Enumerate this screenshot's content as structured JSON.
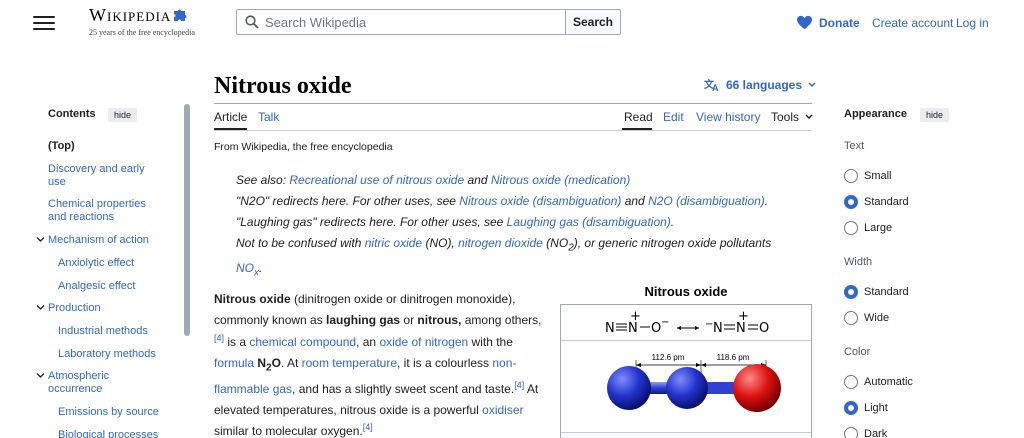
{
  "header": {
    "logo_word": "Wikipedia",
    "logo_tagline": "25 years of the free encyclopedia",
    "search_placeholder": "Search Wikipedia",
    "search_button": "Search",
    "donate": "Donate",
    "create_account": "Create account",
    "log_in": "Log in"
  },
  "page": {
    "title": "Nitrous oxide",
    "languages": "66 languages",
    "tabs": {
      "article": "Article",
      "talk": "Talk",
      "read": "Read",
      "edit": "Edit",
      "view_history": "View history",
      "tools": "Tools"
    },
    "from_wikipedia": "From Wikipedia, the free encyclopedia"
  },
  "hatnotes": {
    "line1": {
      "see_also": "See also: ",
      "link1": "Recreational use of nitrous oxide",
      "and": " and ",
      "link2": "Nitrous oxide (medication)"
    },
    "line2": {
      "pre": "\"N2O\" redirects here. For other uses, see ",
      "link1": "Nitrous oxide (disambiguation)",
      "and": " and ",
      "link2": "N2O (disambiguation)",
      "end": "."
    },
    "line3": {
      "pre": "\"Laughing gas\" redirects here. For other uses, see ",
      "link": "Laughing gas (disambiguation)",
      "end": "."
    },
    "line4": {
      "pre": "Not to be confused with ",
      "link1": "nitric oxide",
      "mid1": " (NO), ",
      "link2": "nitrogen dioxide",
      "mid2": " (NO",
      "sub2": "2",
      "mid3": "), or generic nitrogen oxide pollutants ",
      "link3": "NO",
      "link3_sub": "x",
      "end": "."
    }
  },
  "intro": {
    "t1": "Nitrous oxide",
    "t2": " (dinitrogen oxide or dinitrogen monoxide), commonly known as ",
    "t3": "laughing gas",
    "t4": " or ",
    "t5": "nitrous,",
    "t6": " among others,",
    "ref4a": "[4]",
    "t7": " is a ",
    "link_chem": "chemical compound",
    "t8": ", an ",
    "link_oxide": "oxide of nitrogen",
    "t9": " with the ",
    "link_formula": "formula",
    "t10_b": "N",
    "t10_sub": "2",
    "t10_o": "O",
    "t11": ". At ",
    "link_room": "room temperature",
    "t12": ", it is a colourless ",
    "link_nonflam": "non-flammable gas",
    "t13": ", and has a slightly sweet scent and taste.",
    "ref4b": "[4]",
    "t14": " At elevated temperatures, nitrous oxide is a powerful ",
    "link_oxid": "oxidiser",
    "t15": " similar to molecular oxygen.",
    "ref4c": "[4]"
  },
  "toc": {
    "title": "Contents",
    "hide": "hide",
    "items": [
      {
        "label": "(Top)"
      },
      {
        "label": "Discovery and early use"
      },
      {
        "label": "Chemical properties and reactions"
      },
      {
        "label": "Mechanism of action"
      },
      {
        "label": "Anxiolytic effect"
      },
      {
        "label": "Analgesic effect"
      },
      {
        "label": "Production"
      },
      {
        "label": "Industrial methods"
      },
      {
        "label": "Laboratory methods"
      },
      {
        "label": "Atmospheric occurrence"
      },
      {
        "label": "Emissions by source"
      },
      {
        "label": "Biological processes"
      }
    ]
  },
  "infobox": {
    "title": "Nitrous oxide",
    "bond1": "112.6 pm",
    "bond2": "118.6 pm",
    "colors": {
      "nitrogen": "#2233cc",
      "oxygen": "#dd1111"
    }
  },
  "appearance": {
    "title": "Appearance",
    "hide": "hide",
    "text_label": "Text",
    "text_options": [
      "Small",
      "Standard",
      "Large"
    ],
    "text_selected": "Standard",
    "width_label": "Width",
    "width_options": [
      "Standard",
      "Wide"
    ],
    "width_selected": "Standard",
    "color_label": "Color",
    "color_options": [
      "Automatic",
      "Light",
      "Dark"
    ],
    "color_selected": "Light"
  },
  "colors": {
    "link": "#3366cc",
    "text": "#202122",
    "border": "#a2a9b1"
  }
}
